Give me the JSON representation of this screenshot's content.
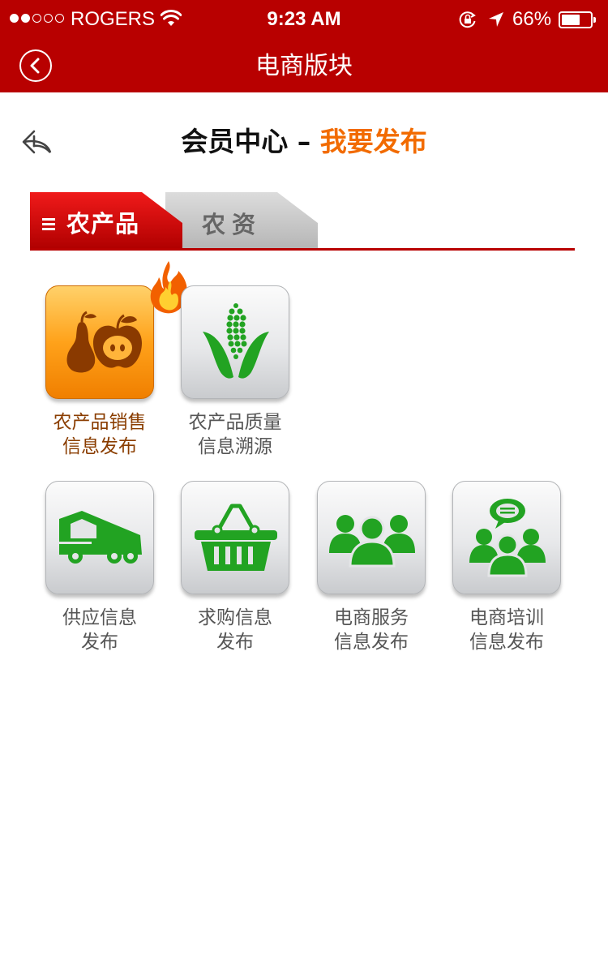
{
  "status_bar": {
    "carrier": "ROGERS",
    "time": "9:23 AM",
    "battery_percent": "66%",
    "battery_level": 0.66,
    "signal_bars": 2
  },
  "nav": {
    "title": "电商版块",
    "back_icon": "chevron-left-circle-icon"
  },
  "page": {
    "heading_part1": "会员中心",
    "heading_dash": "–",
    "heading_part2": "我要发布",
    "back_icon": "reply-arrow-icon"
  },
  "tabs": [
    {
      "label": "农产品",
      "active": true
    },
    {
      "label": "农资",
      "active": false
    }
  ],
  "tiles": [
    {
      "line1": "农产品销售",
      "line2": "信息发布",
      "icon": "fruit-icon",
      "highlighted": true,
      "badge_icon": "flame-icon"
    },
    {
      "line1": "农产品质量",
      "line2": "信息溯源",
      "icon": "corn-icon",
      "highlighted": false
    },
    {
      "line1": "供应信息",
      "line2": "发布",
      "icon": "truck-icon",
      "highlighted": false
    },
    {
      "line1": "求购信息",
      "line2": "发布",
      "icon": "basket-icon",
      "highlighted": false
    },
    {
      "line1": "电商服务",
      "line2": "信息发布",
      "icon": "group-icon",
      "highlighted": false
    },
    {
      "line1": "电商培训",
      "line2": "信息发布",
      "icon": "training-icon",
      "highlighted": false
    }
  ],
  "colors": {
    "brand_red": "#b80000",
    "accent_orange": "#f26b00",
    "icon_green": "#1aa01a",
    "tile_highlight": "#ffa21a"
  }
}
